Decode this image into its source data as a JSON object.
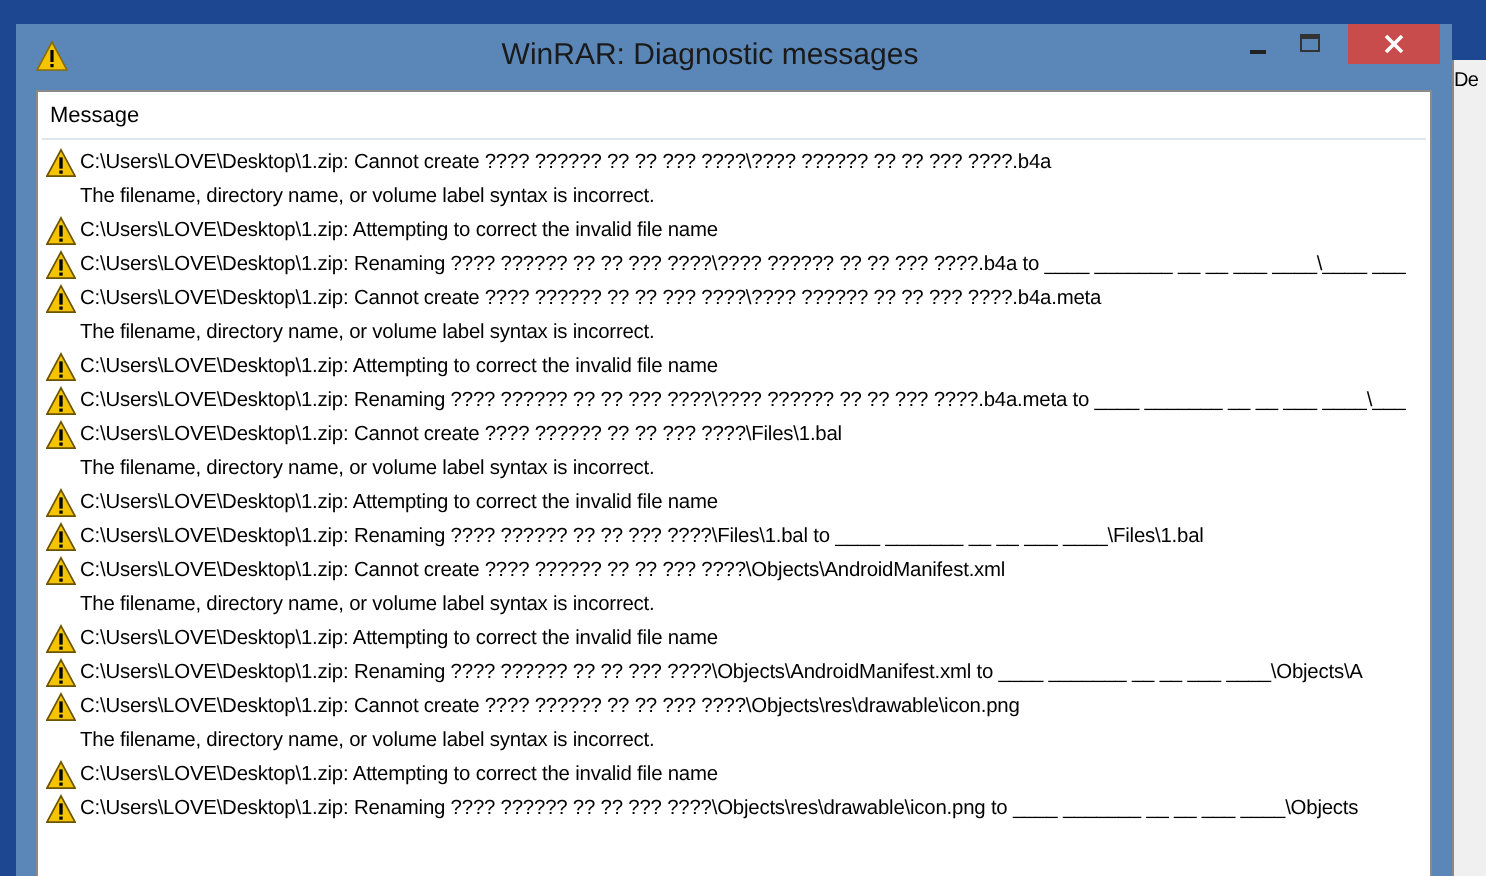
{
  "window": {
    "title": "WinRAR: Diagnostic messages"
  },
  "background_window": {
    "text": "De"
  },
  "list": {
    "column": "Message",
    "rows": [
      {
        "kind": "warning",
        "text": "C:\\Users\\LOVE\\Desktop\\1.zip: Cannot create ???? ?????? ?? ?? ??? ????\\???? ?????? ?? ?? ??? ????.b4a"
      },
      {
        "kind": "detail",
        "text": "The filename, directory name, or volume label syntax is incorrect."
      },
      {
        "kind": "warning",
        "text": "C:\\Users\\LOVE\\Desktop\\1.zip: Attempting to correct the invalid file name"
      },
      {
        "kind": "warning",
        "text": "C:\\Users\\LOVE\\Desktop\\1.zip: Renaming ???? ?????? ?? ?? ??? ????\\???? ?????? ?? ?? ??? ????.b4a to ____ _______ __ __ ___ ____\\____ ___"
      },
      {
        "kind": "warning",
        "text": "C:\\Users\\LOVE\\Desktop\\1.zip: Cannot create ???? ?????? ?? ?? ??? ????\\???? ?????? ?? ?? ??? ????.b4a.meta"
      },
      {
        "kind": "detail",
        "text": "The filename, directory name, or volume label syntax is incorrect."
      },
      {
        "kind": "warning",
        "text": "C:\\Users\\LOVE\\Desktop\\1.zip: Attempting to correct the invalid file name"
      },
      {
        "kind": "warning",
        "text": "C:\\Users\\LOVE\\Desktop\\1.zip: Renaming ???? ?????? ?? ?? ??? ????\\???? ?????? ?? ?? ??? ????.b4a.meta to ____ _______ __ __ ___ ____\\___"
      },
      {
        "kind": "warning",
        "text": "C:\\Users\\LOVE\\Desktop\\1.zip: Cannot create ???? ?????? ?? ?? ??? ????\\Files\\1.bal"
      },
      {
        "kind": "detail",
        "text": "The filename, directory name, or volume label syntax is incorrect."
      },
      {
        "kind": "warning",
        "text": "C:\\Users\\LOVE\\Desktop\\1.zip: Attempting to correct the invalid file name"
      },
      {
        "kind": "warning",
        "text": "C:\\Users\\LOVE\\Desktop\\1.zip: Renaming ???? ?????? ?? ?? ??? ????\\Files\\1.bal to ____ _______ __ __ ___ ____\\Files\\1.bal"
      },
      {
        "kind": "warning",
        "text": "C:\\Users\\LOVE\\Desktop\\1.zip: Cannot create ???? ?????? ?? ?? ??? ????\\Objects\\AndroidManifest.xml"
      },
      {
        "kind": "detail",
        "text": "The filename, directory name, or volume label syntax is incorrect."
      },
      {
        "kind": "warning",
        "text": "C:\\Users\\LOVE\\Desktop\\1.zip: Attempting to correct the invalid file name"
      },
      {
        "kind": "warning",
        "text": "C:\\Users\\LOVE\\Desktop\\1.zip: Renaming ???? ?????? ?? ?? ??? ????\\Objects\\AndroidManifest.xml to ____ _______ __ __ ___ ____\\Objects\\A"
      },
      {
        "kind": "warning",
        "text": "C:\\Users\\LOVE\\Desktop\\1.zip: Cannot create ???? ?????? ?? ?? ??? ????\\Objects\\res\\drawable\\icon.png"
      },
      {
        "kind": "detail",
        "text": "The filename, directory name, or volume label syntax is incorrect."
      },
      {
        "kind": "warning",
        "text": "C:\\Users\\LOVE\\Desktop\\1.zip: Attempting to correct the invalid file name"
      },
      {
        "kind": "warning",
        "text": "C:\\Users\\LOVE\\Desktop\\1.zip: Renaming ???? ?????? ?? ?? ??? ????\\Objects\\res\\drawable\\icon.png to ____ _______ __ __ ___ ____\\Objects"
      }
    ]
  }
}
